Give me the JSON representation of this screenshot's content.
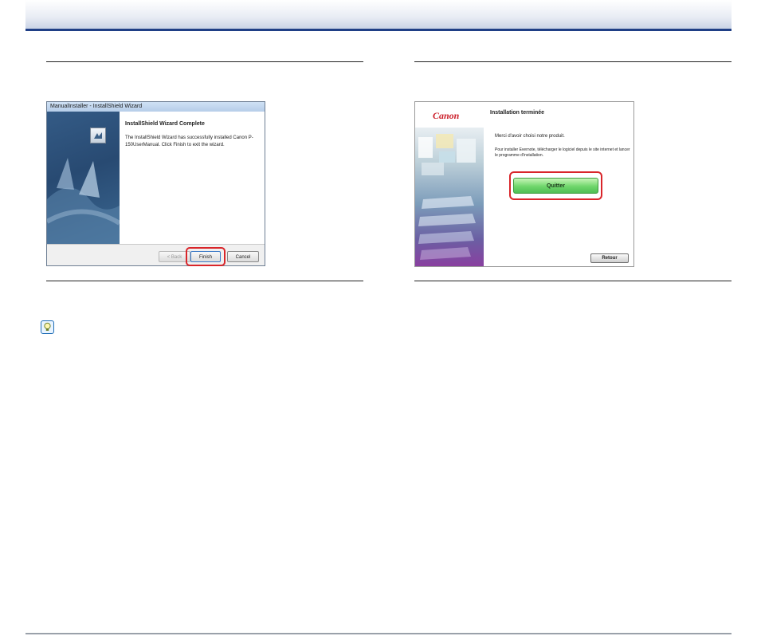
{
  "installshield_dialog": {
    "window_title": "ManualInstaller - InstallShield Wizard",
    "heading": "InstallShield Wizard Complete",
    "message": "The InstallShield Wizard has successfully installed Canon P-150UserManual.  Click Finish to exit the wizard.",
    "back_label": "< Back",
    "finish_label": "Finish",
    "cancel_label": "Cancel",
    "icon": "installer-icon"
  },
  "canon_screen": {
    "logo": "Canon",
    "title": "Installation terminée",
    "message": "Merci d'avoir choisi notre produit.",
    "note": "Pour installer Evernote, télécharger le logiciel depuis le site internet et lancer le programme d'installation.",
    "quit_label": "Quitter",
    "back_label": "Retour"
  },
  "tip": {
    "icon": "lightbulb-icon"
  },
  "colors": {
    "header_rule": "#1f3f86",
    "highlight": "#d9252a",
    "quit_button": "#6fd66b",
    "canon_red": "#cc1f2a"
  }
}
